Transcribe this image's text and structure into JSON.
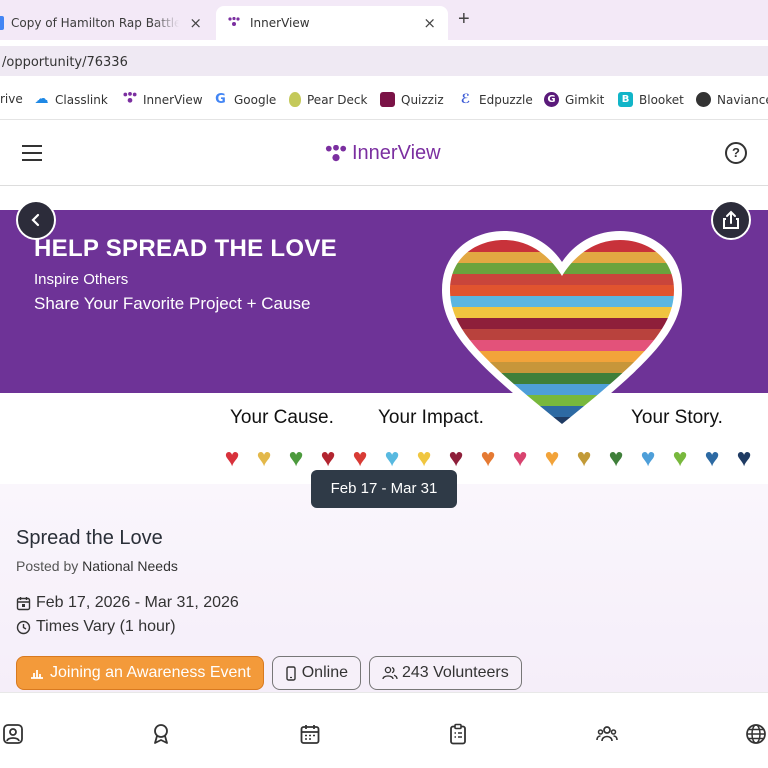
{
  "browser": {
    "tabs": [
      {
        "title": "Copy of Hamilton Rap Battle Ju",
        "close": "×"
      },
      {
        "title": "InnerView",
        "close": "×"
      }
    ],
    "new_tab": "+",
    "url": "/opportunity/76336",
    "bookmarks": [
      {
        "label": "rive",
        "icon": "drive-icon"
      },
      {
        "label": "Classlink",
        "icon": "cloud-icon",
        "color": "#1e88e5"
      },
      {
        "label": "InnerView",
        "icon": "innerview-icon",
        "color": "#7b2fa0"
      },
      {
        "label": "Google",
        "icon": "google-icon"
      },
      {
        "label": "Pear Deck",
        "icon": "pear-icon",
        "color": "#8fae3a"
      },
      {
        "label": "Quizziz",
        "icon": "quizziz-icon",
        "color": "#7a1246"
      },
      {
        "label": "Edpuzzle",
        "icon": "edpuzzle-icon",
        "color": "#3c5bd6"
      },
      {
        "label": "Gimkit",
        "icon": "gimkit-icon",
        "color": "#5a1a7a"
      },
      {
        "label": "Blooket",
        "icon": "blooket-icon",
        "color": "#11b5c8"
      },
      {
        "label": "Naviance",
        "icon": "globe-icon",
        "color": "#333333"
      }
    ]
  },
  "app": {
    "brand": "InnerView",
    "help_icon": "?"
  },
  "banner": {
    "headline": "HELP SPREAD THE LOVE",
    "sub1": "Inspire Others",
    "sub2": "Share Your Favorite Project + Cause",
    "tag1": "Your Cause.",
    "tag2": "Your Impact.",
    "tag3": "Your Story.",
    "hearts": [
      "#d8323c",
      "#e3b84a",
      "#4c9a3d",
      "#b22530",
      "#d83b35",
      "#58b9e0",
      "#f0c640",
      "#8e1f3a",
      "#e57a33",
      "#d8436f",
      "#f2a33a",
      "#c29a37",
      "#3f7f3a",
      "#4e9fd9",
      "#78b83d",
      "#2d6aa3",
      "#1f3b63"
    ]
  },
  "opportunity": {
    "date_pill": "Feb 17 - Mar 31",
    "title": "Spread the Love",
    "posted_by_label": "Posted by",
    "posted_by": "National Needs",
    "date_range": "Feb 17, 2026 - Mar 31, 2026",
    "time": "Times Vary (1 hour)",
    "chips": {
      "category": "Joining an Awareness Event",
      "location": "Online",
      "volunteers": "243 Volunteers"
    }
  },
  "bottom_nav": [
    "profile-icon",
    "award-icon",
    "calendar-icon",
    "clipboard-icon",
    "group-icon",
    "globe-icon"
  ]
}
